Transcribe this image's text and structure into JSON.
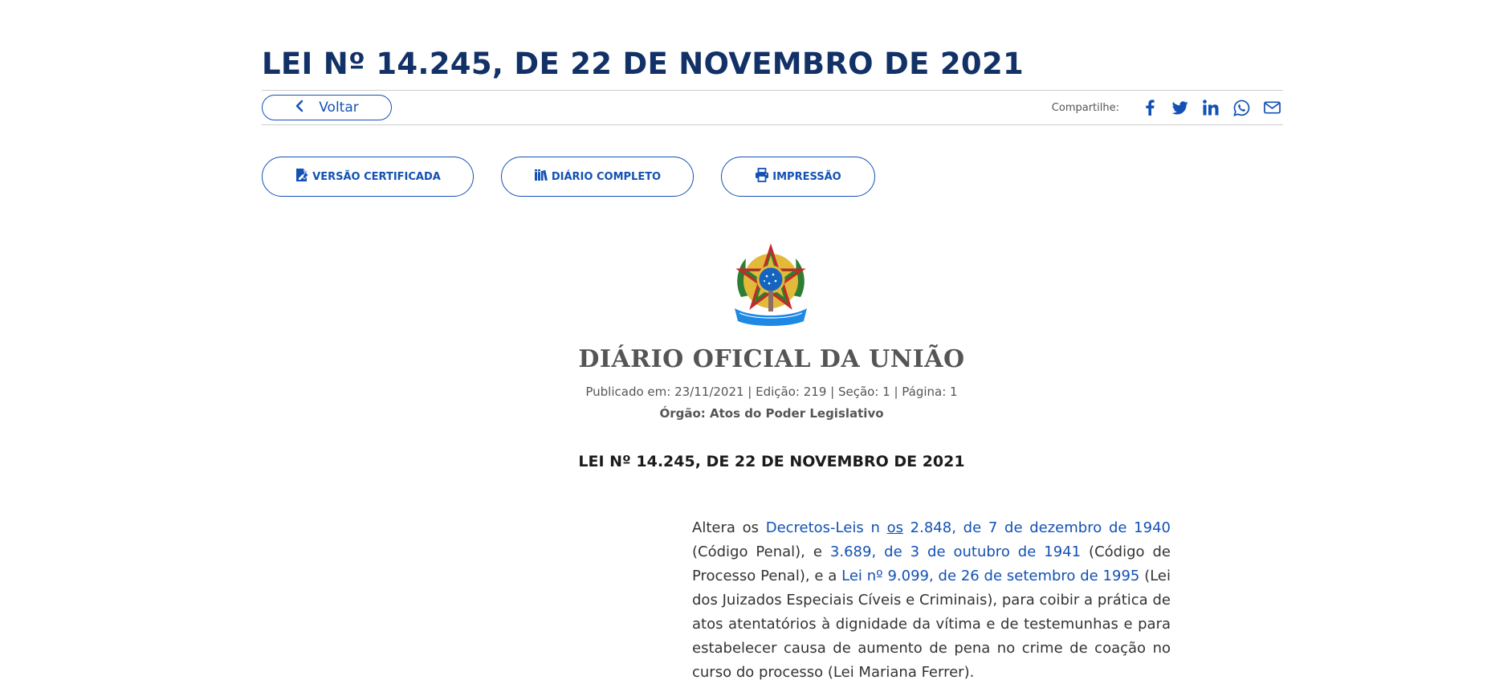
{
  "page": {
    "title": "LEI Nº 14.245, DE 22 DE NOVEMBRO DE 2021"
  },
  "toolbar": {
    "back_label": "Voltar",
    "share_label": "Compartilhe:",
    "share_icons": [
      "facebook-icon",
      "twitter-icon",
      "linkedin-icon",
      "whatsapp-icon",
      "email-icon"
    ]
  },
  "actions": {
    "certified": "VERSÃO CERTIFICADA",
    "full_diary": "DIÁRIO COMPLETO",
    "print": "IMPRESSÃO"
  },
  "document": {
    "masthead": "DIÁRIO OFICIAL DA UNIÃO",
    "published": "Publicado em: 23/11/2021 | Edição: 219 | Seção: 1 | Página: 1",
    "orgao": "Órgão: Atos do Poder Legislativo",
    "law_heading": "LEI Nº 14.245, DE 22 DE NOVEMBRO DE 2021",
    "ementa": {
      "t1": "Altera os ",
      "link1a": "Decretos-Leis n ",
      "link1b": "os",
      "link1c": " 2.848, de 7 de dezembro de 1940",
      "t2": " (Código Penal), e ",
      "link2": "3.689, de 3 de outubro de 1941",
      "t3": " (Código de Processo Penal), e a ",
      "link3": "Lei nº 9.099, de 26 de setembro de 1995",
      "t4": " (Lei dos Juizados Especiais Cíveis e Criminais), para coibir a prática de atos atentatórios à dignidade da vítima e de testemunhas e para estabelecer causa de aumento de pena no crime de coação no curso do processo (Lei Mariana Ferrer)."
    }
  },
  "colors": {
    "title": "#123167",
    "accent": "#1351b4",
    "text": "#333333",
    "muted": "#555555"
  }
}
